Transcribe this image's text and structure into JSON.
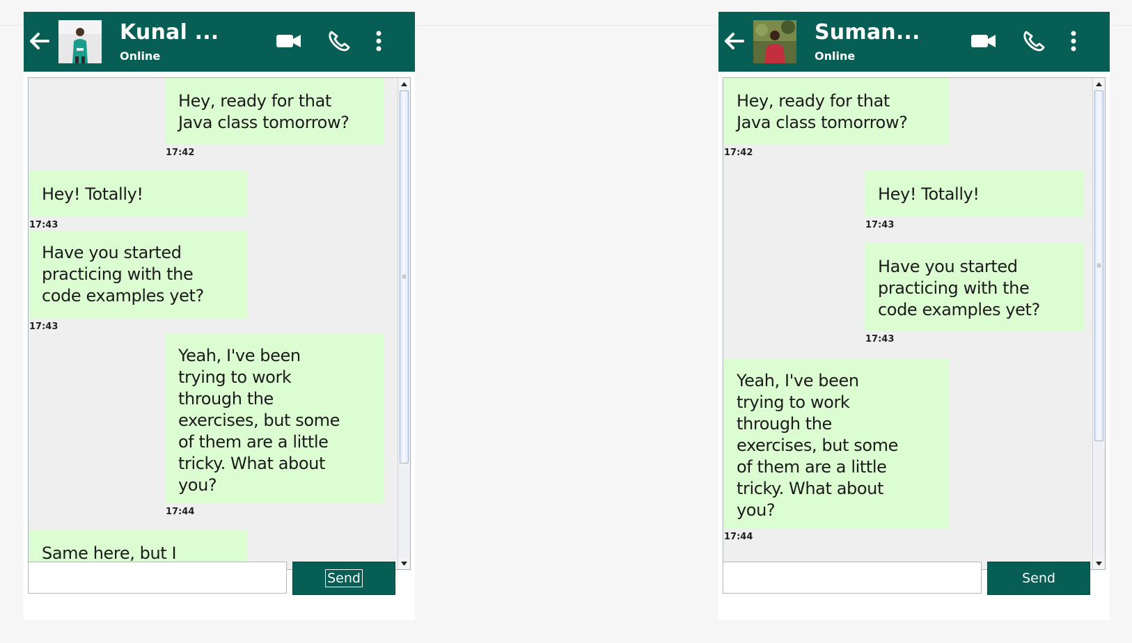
{
  "left": {
    "contact": {
      "name": "Kunal ...",
      "status": "Online"
    },
    "messages": [
      {
        "text": "Hey, ready for that\nJava class tomorrow?",
        "time": "17:42"
      },
      {
        "text": "Hey! Totally!",
        "time": "17:43"
      },
      {
        "text": "Have you started\npracticing with the\ncode examples yet?",
        "time": "17:43"
      },
      {
        "text": "Yeah, I've been\ntrying to work\nthrough the\nexercises, but some\nof them are a little\ntricky. What about\nyou?",
        "time": "17:44"
      },
      {
        "text": "Same here, but I",
        "time": ""
      }
    ],
    "input": {
      "value": ""
    },
    "send_label": "Send"
  },
  "right": {
    "contact": {
      "name": "Suman...",
      "status": "Online"
    },
    "messages": [
      {
        "text": "Hey, ready for that\nJava class tomorrow?",
        "time": "17:42"
      },
      {
        "text": "Hey! Totally!",
        "time": "17:43"
      },
      {
        "text": "Have you started\npracticing with the\ncode examples yet?",
        "time": "17:43"
      },
      {
        "text": "Yeah, I've been\ntrying to work\nthrough the\nexercises, but some\nof them are a little\ntricky. What about\nyou?",
        "time": "17:44"
      }
    ],
    "input": {
      "value": ""
    },
    "send_label": "Send"
  },
  "icons": {
    "back": "arrow-left-icon",
    "video": "video-camera-icon",
    "call": "phone-icon",
    "menu": "more-vertical-icon"
  },
  "colors": {
    "header": "#075e54",
    "bubble": "#dcfcd2",
    "chat_background": "#efefef"
  }
}
